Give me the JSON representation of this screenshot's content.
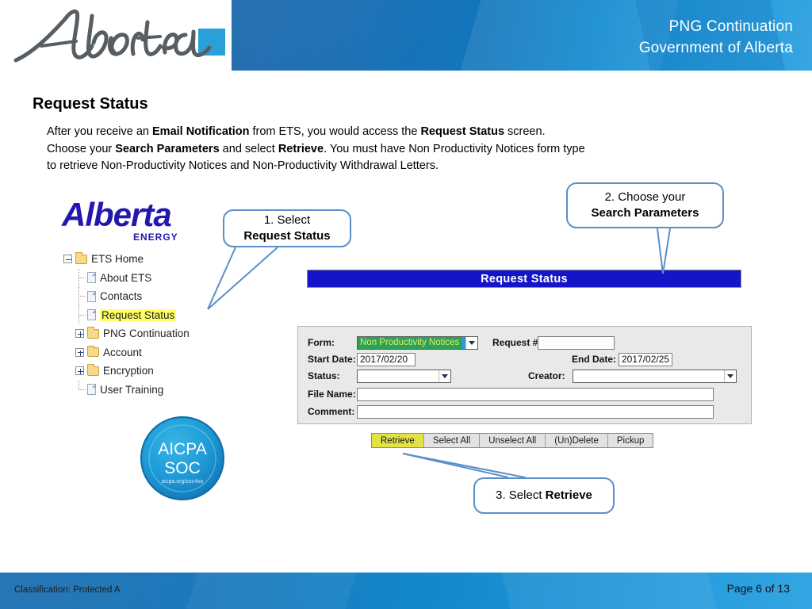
{
  "header": {
    "logo_name": "alberta-wordmark",
    "title_line1": "PNG Continuation",
    "title_line2": "Government of Alberta",
    "band_color": "#1277bd",
    "accent_color": "#29a0d8"
  },
  "slide": {
    "title": "Request Status",
    "body_line1_a": "After you receive an ",
    "body_line1_b": "Email Notification",
    "body_line1_c": " from ETS, you would access the ",
    "body_line1_d": "Request Status",
    "body_line1_e": " screen.",
    "body_line2_a": "Choose your ",
    "body_line2_b": "Search Parameters",
    "body_line2_c": " and select ",
    "body_line2_d": "Retrieve",
    "body_line2_e": ".  You must have Non Productivity Notices form type",
    "body_line3": "to retrieve Non-Productivity Notices and Non-Productivity Withdrawal Letters."
  },
  "energy_logo": {
    "wordmark": "Alberta",
    "subtext": "ENERGY",
    "color": "#2318ad"
  },
  "tree": {
    "items": [
      {
        "label": "ETS Home",
        "icon": "folder-icon",
        "expander": "minus",
        "level": 0,
        "highlight": false
      },
      {
        "label": "About ETS",
        "icon": "page-icon",
        "expander": "none",
        "level": 1,
        "highlight": false
      },
      {
        "label": "Contacts",
        "icon": "page-icon",
        "expander": "none",
        "level": 1,
        "highlight": false
      },
      {
        "label": "Request Status",
        "icon": "page-icon",
        "expander": "none",
        "level": 1,
        "highlight": true
      },
      {
        "label": "PNG Continuation",
        "icon": "folder-icon",
        "expander": "plus",
        "level": 1,
        "highlight": false
      },
      {
        "label": "Account",
        "icon": "folder-icon",
        "expander": "plus",
        "level": 1,
        "highlight": false
      },
      {
        "label": "Encryption",
        "icon": "folder-icon",
        "expander": "plus",
        "level": 1,
        "highlight": false
      },
      {
        "label": "User Training",
        "icon": "page-icon",
        "expander": "none",
        "level": 1,
        "highlight": false
      }
    ],
    "highlight_color": "#ffff66"
  },
  "aicpa_badge": {
    "line1": "AICPA",
    "line2": "SOC",
    "line3": "aicpa.org/soc4so",
    "color": "#1e9bd7"
  },
  "app": {
    "page_banner": "Request Status",
    "banner_bg": "#1414c8",
    "fields": [
      {
        "name": "form",
        "label": "Form:",
        "type": "select",
        "value": "Non Productivity Notices"
      },
      {
        "name": "request_no",
        "label": "Request #:",
        "type": "text",
        "value": ""
      },
      {
        "name": "start_date",
        "label": "Start Date:",
        "type": "text",
        "value": "2017/02/20"
      },
      {
        "name": "end_date",
        "label": "End Date:",
        "type": "text",
        "value": "2017/02/25"
      },
      {
        "name": "status",
        "label": "Status:",
        "type": "select",
        "value": ""
      },
      {
        "name": "creator",
        "label": "Creator:",
        "type": "select",
        "value": ""
      },
      {
        "name": "file_name",
        "label": "File Name:",
        "type": "text",
        "value": ""
      },
      {
        "name": "comment",
        "label": "Comment:",
        "type": "text",
        "value": ""
      }
    ],
    "buttons": [
      {
        "label": "Retrieve",
        "active": true
      },
      {
        "label": "Select All",
        "active": false
      },
      {
        "label": "Unselect All",
        "active": false
      },
      {
        "label": "(Un)Delete",
        "active": false
      },
      {
        "label": "Pickup",
        "active": false
      }
    ],
    "active_button_color": "#e2e243"
  },
  "callouts": [
    {
      "id": 1,
      "line1": "1. Select",
      "line2": "Request Status",
      "bold_line2": true
    },
    {
      "id": 2,
      "line1": "2. Choose your",
      "line2": "Search Parameters",
      "bold_line2": true
    },
    {
      "id": 3,
      "line1": "3. Select ",
      "line2": "Retrieve",
      "bold_line2": true
    }
  ],
  "footer": {
    "classification": "Classification: Protected A",
    "page": "Page 6 of 13"
  }
}
